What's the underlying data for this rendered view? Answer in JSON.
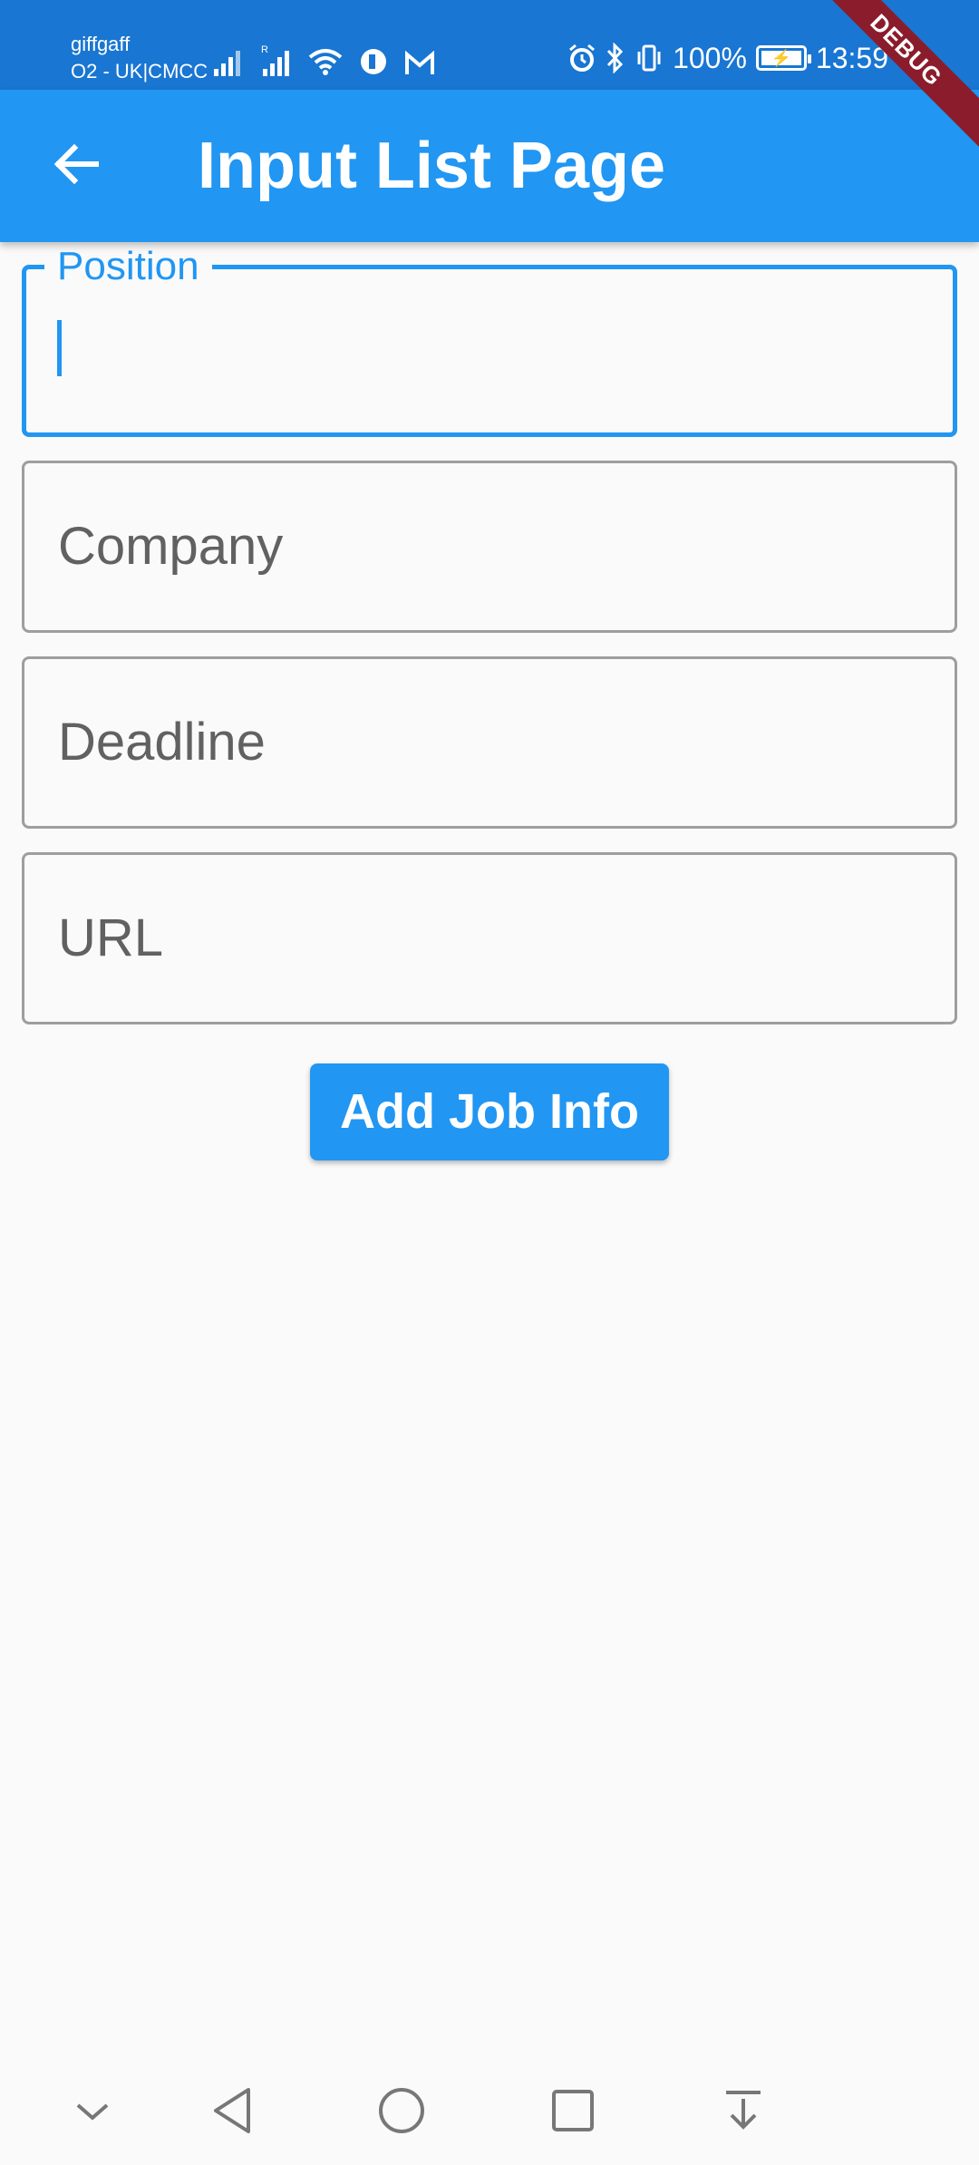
{
  "status_bar": {
    "carrier_line1": "giffgaff",
    "carrier_line2": "O2 - UK|CMCC",
    "battery_percent": "100%",
    "time": "13:59",
    "icons": [
      "signal-icon",
      "signal-roaming-icon",
      "wifi-icon",
      "app-notification-icon",
      "gmail-icon",
      "alarm-icon",
      "bluetooth-icon",
      "vibrate-icon",
      "battery-charging-icon"
    ]
  },
  "debug_banner": "DEBUG",
  "app_bar": {
    "title": "Input List Page",
    "back_icon": "arrow-back-icon"
  },
  "form": {
    "position": {
      "label": "Position",
      "value": "",
      "focused": true
    },
    "company": {
      "placeholder": "Company",
      "value": ""
    },
    "deadline": {
      "placeholder": "Deadline",
      "value": ""
    },
    "url": {
      "placeholder": "URL",
      "value": ""
    },
    "submit_label": "Add Job Info"
  },
  "colors": {
    "primary": "#2196f3",
    "status_bar": "#1976d2",
    "background": "#fafafa",
    "border": "#9e9e9e",
    "hint_text": "#616161",
    "debug_ribbon": "#8b1c2b"
  },
  "nav_bar": {
    "buttons": [
      "chevron-down-icon",
      "back-triangle-icon",
      "home-circle-icon",
      "recents-square-icon",
      "notification-pull-icon"
    ]
  }
}
